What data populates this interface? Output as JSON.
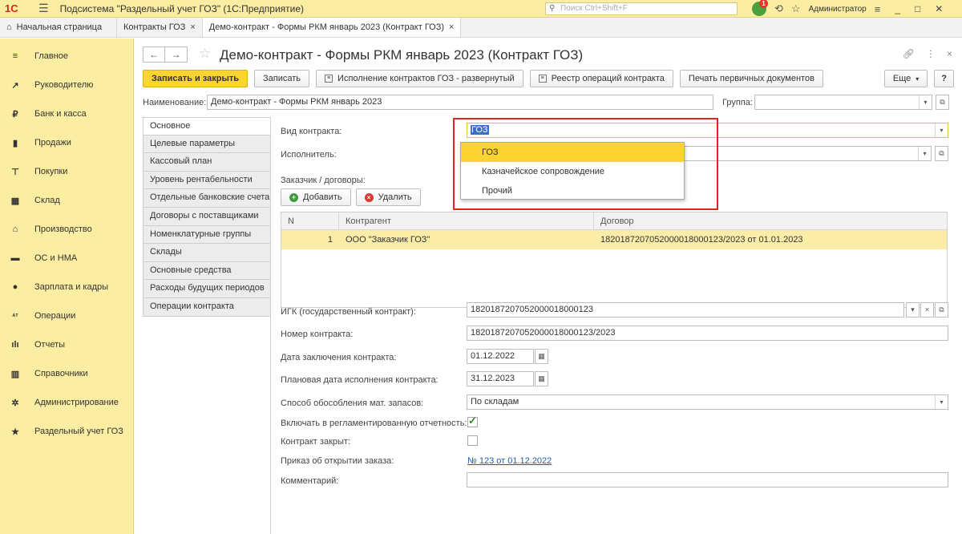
{
  "titlebar": {
    "logo": "1С",
    "title": "Подсистема \"Раздельный учет ГОЗ\"  (1С:Предприятие)",
    "search_placeholder": "Поиск Ctrl+Shift+F",
    "notif_count": "1",
    "user": "Администратор"
  },
  "tabs": [
    {
      "label": "Начальная страница"
    },
    {
      "label": "Контракты ГОЗ"
    },
    {
      "label": "Демо-контракт - Формы РКМ январь 2023 (Контракт ГОЗ)"
    }
  ],
  "sidebar": {
    "items": [
      {
        "label": "Главное",
        "icon": "menu-icon"
      },
      {
        "label": "Руководителю",
        "icon": "trend-icon"
      },
      {
        "label": "Банк и касса",
        "icon": "ruble-icon"
      },
      {
        "label": "Продажи",
        "icon": "bag-icon"
      },
      {
        "label": "Покупки",
        "icon": "cart-icon"
      },
      {
        "label": "Склад",
        "icon": "warehouse-icon"
      },
      {
        "label": "Производство",
        "icon": "factory-icon"
      },
      {
        "label": "ОС и НМА",
        "icon": "truck-icon"
      },
      {
        "label": "Зарплата и кадры",
        "icon": "person-icon"
      },
      {
        "label": "Операции",
        "icon": "operations-icon"
      },
      {
        "label": "Отчеты",
        "icon": "chart-icon"
      },
      {
        "label": "Справочники",
        "icon": "book-icon"
      },
      {
        "label": "Администрирование",
        "icon": "gear-icon"
      },
      {
        "label": "Раздельный учет ГОЗ",
        "icon": "star-icon"
      }
    ]
  },
  "form": {
    "title": "Демо-контракт - Формы РКМ январь 2023 (Контракт ГОЗ)",
    "toolbar": {
      "save_close": "Записать и закрыть",
      "save": "Записать",
      "execution": "Исполнение контрактов ГОЗ - развернутый",
      "registry": "Реестр операций контракта",
      "print": "Печать первичных документов",
      "more": "Еще",
      "help": "?"
    },
    "name_label": "Наименование:",
    "name_value": "Демо-контракт - Формы РКМ январь 2023",
    "group_label": "Группа:",
    "group_value": "",
    "vtabs": [
      "Основное",
      "Целевые параметры",
      "Кассовый план",
      "Уровень рентабельности",
      "Отдельные банковские счета",
      "Договоры с поставщиками",
      "Номенклатурные группы",
      "Склады",
      "Основные средства",
      "Расходы будущих периодов",
      "Операции контракта"
    ],
    "contract_type_label": "Вид контракта:",
    "contract_type_value": "ГОЗ",
    "executor_label": "Исполнитель:",
    "executor_value": "",
    "customers_label": "Заказчик / договоры:",
    "add_label": "Добавить",
    "delete_label": "Удалить",
    "table": {
      "headers": [
        "N",
        "Контрагент",
        "Договор"
      ],
      "rows": [
        {
          "n": "1",
          "counterparty": "ООО \"Заказчик ГОЗ\"",
          "contract": "1820187207052000018000123/2023 от 01.01.2023"
        }
      ]
    },
    "igk_label": "ИГК (государственный контракт):",
    "igk_value": "1820187207052000018000123",
    "number_label": "Номер контракта:",
    "number_value": "1820187207052000018000123/2023",
    "date_label": "Дата заключения контракта:",
    "date_value": "01.12.2022",
    "plan_date_label": "Плановая дата исполнения контракта:",
    "plan_date_value": "31.12.2023",
    "separation_label": "Способ обособления мат. запасов:",
    "separation_value": "По складам",
    "include_label": "Включать в регламентированную отчетность:",
    "include_checked": true,
    "closed_label": "Контракт закрыт:",
    "closed_checked": false,
    "order_label": "Приказ об открытии заказа:",
    "order_link": "№ 123 от 01.12.2022",
    "comment_label": "Комментарий:",
    "comment_value": ""
  },
  "popup": {
    "options": [
      "ГОЗ",
      "Казначейское сопровождение",
      "Прочий"
    ],
    "selected": "ГОЗ"
  },
  "colors": {
    "accent_yellow": "#fbd432",
    "sidebar_bg": "#fbeda1",
    "highlight_red": "#e32222",
    "link_blue": "#1a5ea8"
  }
}
